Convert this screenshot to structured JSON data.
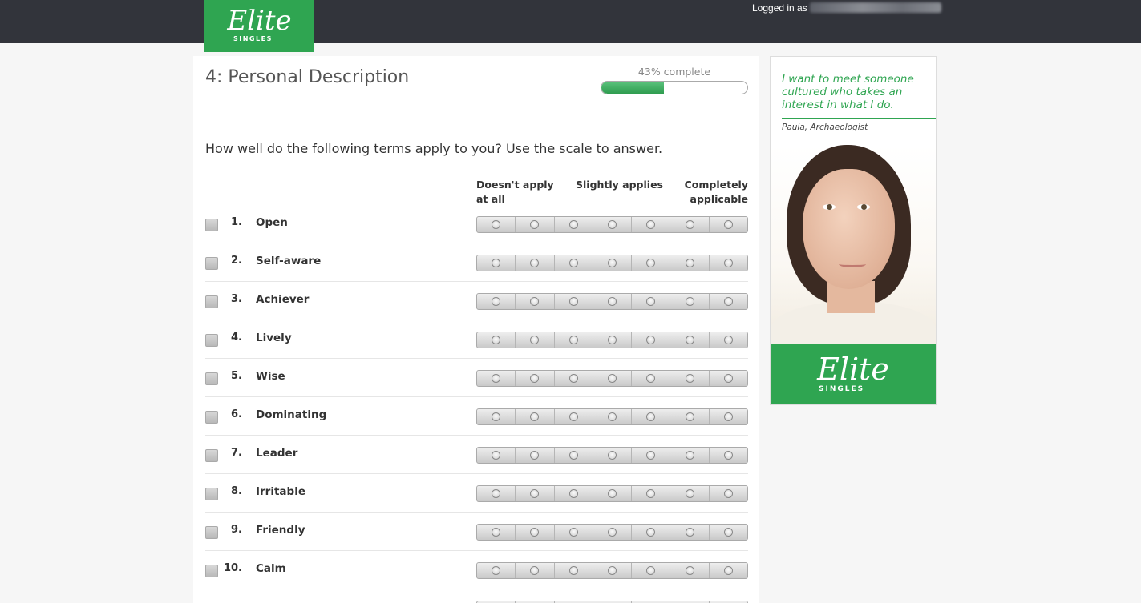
{
  "header": {
    "brand": {
      "name": "Elite",
      "sub": "SINGLES"
    },
    "logged_in_label": "Logged in as"
  },
  "page": {
    "title": "4: Personal Description",
    "progress_label": "43% complete",
    "progress_value": 0.43,
    "question": "How well do the following terms apply to you? Use the scale to answer.",
    "scale": {
      "left": "Doesn't apply at all",
      "middle": "Slightly applies",
      "right": "Completely applicable",
      "points": 7
    },
    "items": [
      {
        "num": "1.",
        "term": "Open"
      },
      {
        "num": "2.",
        "term": "Self-aware"
      },
      {
        "num": "3.",
        "term": "Achiever"
      },
      {
        "num": "4.",
        "term": "Lively"
      },
      {
        "num": "5.",
        "term": "Wise"
      },
      {
        "num": "6.",
        "term": "Dominating"
      },
      {
        "num": "7.",
        "term": "Leader"
      },
      {
        "num": "8.",
        "term": "Irritable"
      },
      {
        "num": "9.",
        "term": "Friendly"
      },
      {
        "num": "10.",
        "term": "Calm"
      }
    ]
  },
  "ad": {
    "quote": "I want to meet someone cultured who takes an interest in what I do.",
    "author": "Paula, Archaeologist",
    "brand": {
      "name": "Elite",
      "sub": "SINGLES"
    }
  },
  "colors": {
    "brand_green": "#2fa551",
    "topbar": "#32343b",
    "background": "#f6f6f6"
  }
}
